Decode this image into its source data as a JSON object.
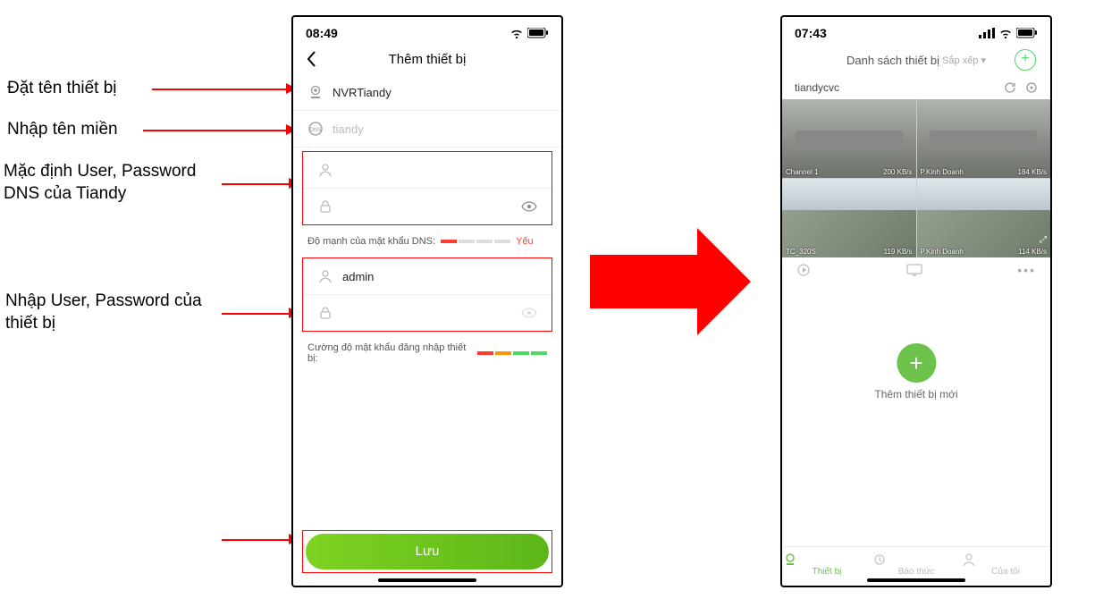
{
  "labels": {
    "device_name": "Đặt tên thiết bị",
    "domain_name": "Nhập tên miền",
    "dns_creds": "Mặc định User, Password\nDNS của Tiandy",
    "device_creds": "Nhập User, Password của\nthiết bị"
  },
  "phone_a": {
    "time": "08:49",
    "title": "Thêm thiết bị",
    "rows": {
      "name_value": "NVRTiandy",
      "domain_value": "tiandy",
      "dns_user": "",
      "dns_pass": "",
      "device_user": "admin",
      "device_pass": ""
    },
    "strength_dns_label": "Độ mạnh của mật khẩu DNS:",
    "strength_dns_word": "Yếu",
    "strength_dev_label": "Cường độ mật khẩu đăng nhập thiết bị:",
    "save": "Lưu"
  },
  "phone_b": {
    "time": "07:43",
    "header": "Danh sách thiết bị",
    "sort": "Sắp xếp ▾",
    "device": "tiandycvc",
    "cells": [
      {
        "l": "Channel 1",
        "r": "200 KB/s"
      },
      {
        "l": "P.Kinh Doanh",
        "r": "184 KB/s"
      },
      {
        "l": "TC_320S",
        "r": "119 KB/s"
      },
      {
        "l": "P.Kinh Doanh",
        "r": "114 KB/s"
      }
    ],
    "add_device": "Thêm thiết bị mới",
    "tabs": {
      "devices": "Thiết bị",
      "alarm": "Báo thức",
      "mine": "Của tôi"
    }
  }
}
